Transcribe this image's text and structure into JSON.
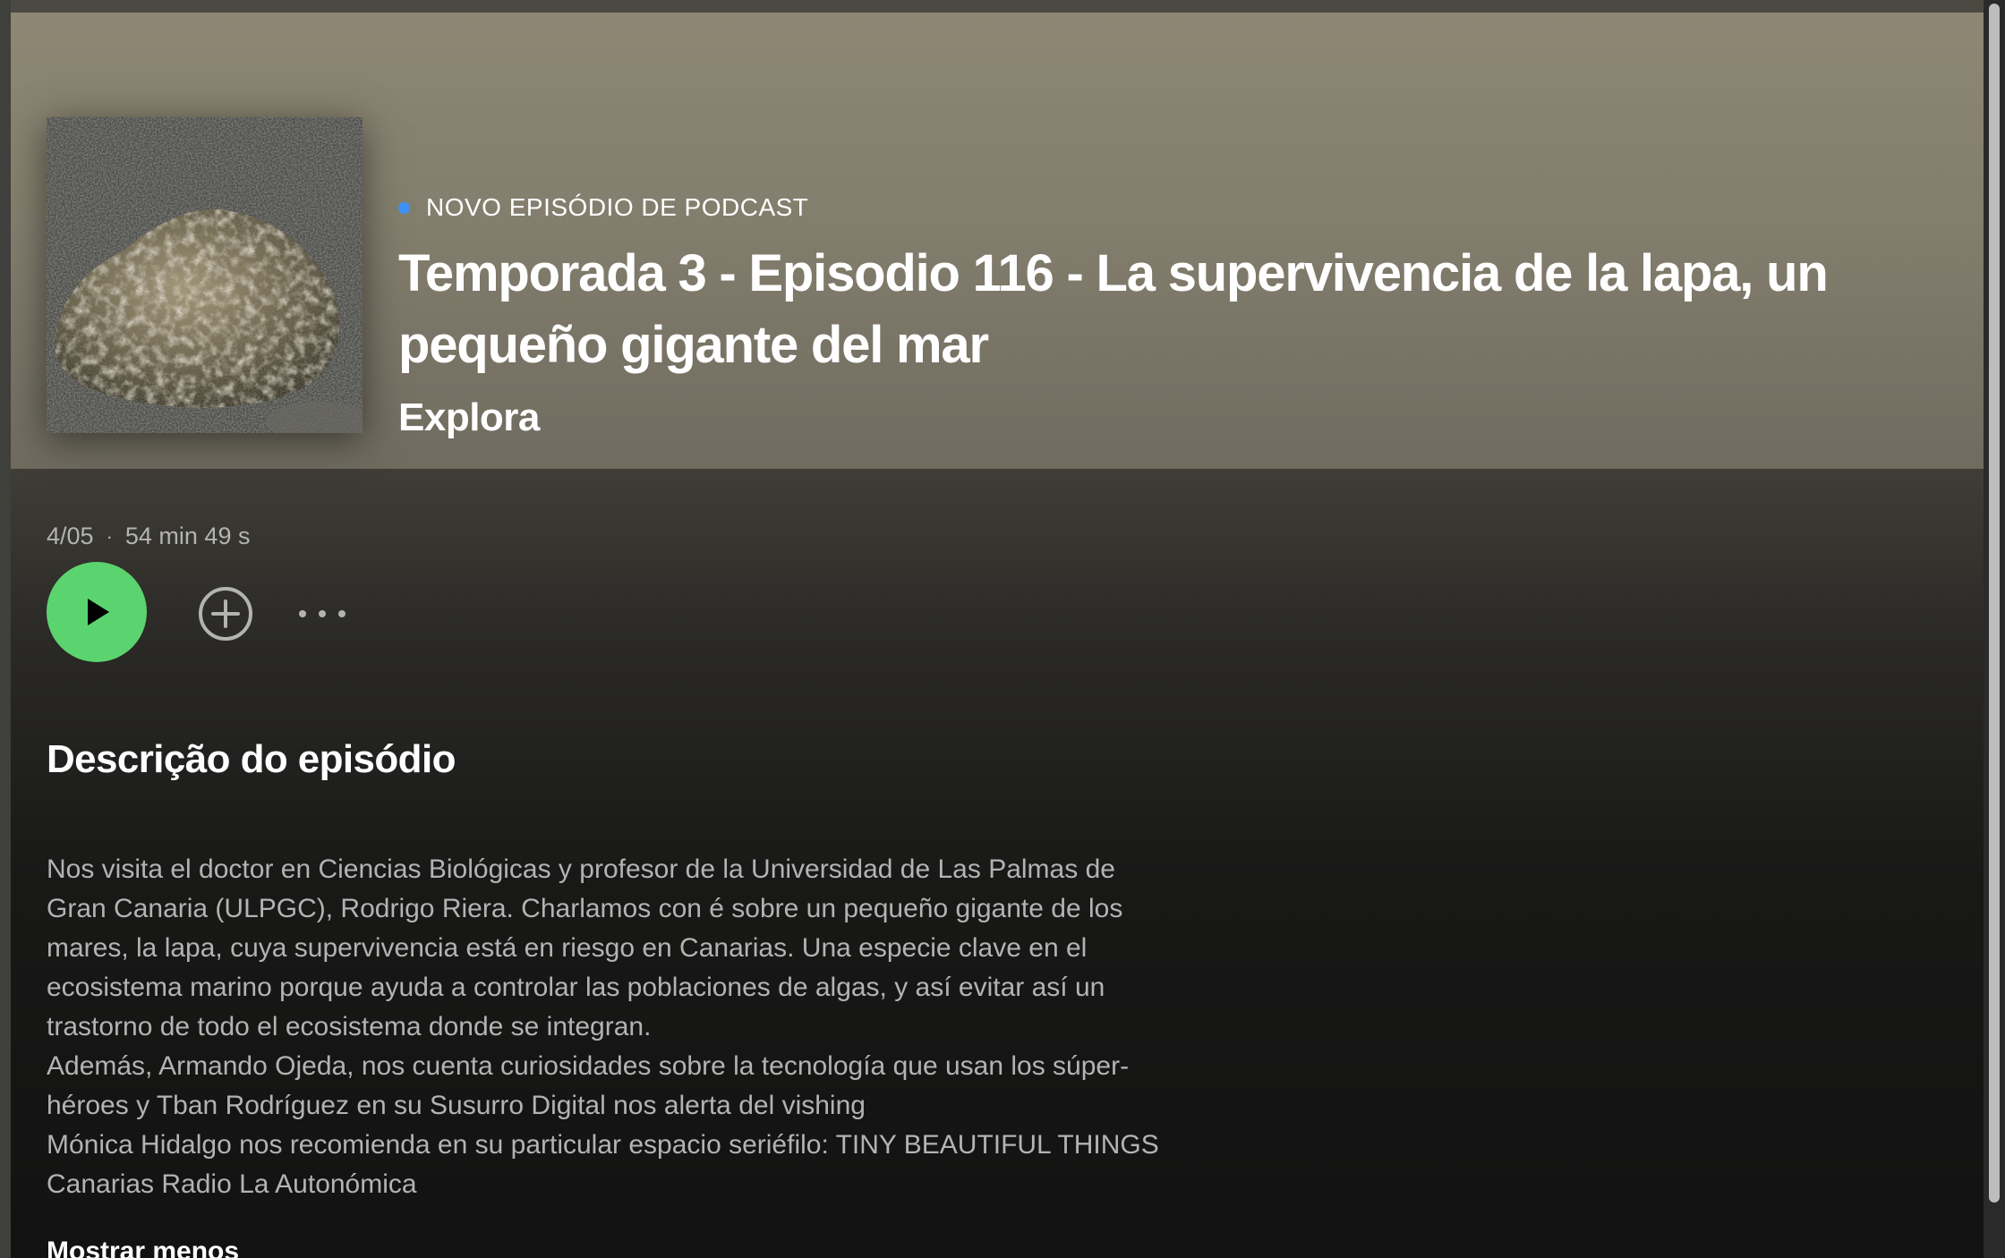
{
  "episode": {
    "kicker": "NOVO EPISÓDIO DE PODCAST",
    "title": "Temporada 3 - Episodio 116 - La supervivencia de la lapa, un pequeño gigante del mar",
    "show": "Explora",
    "date": "4/05",
    "separator": "·",
    "duration": "54 min 49 s"
  },
  "actions": {
    "play": "play-icon",
    "add": "plus-circle-icon",
    "more": "more-dots-icon"
  },
  "description": {
    "heading": "Descrição do episódio",
    "lines": [
      "Nos visita el doctor en Ciencias Biológicas y profesor de la Universidad de Las Palmas de",
      "Gran Canaria (ULPGC), Rodrigo Riera. Charlamos con é sobre un pequeño gigante de los",
      "mares, la lapa, cuya supervivencia está en riesgo en Canarias. Una especie clave en el",
      "ecosistema marino porque ayuda a controlar las poblaciones de algas, y así evitar así un",
      "trastorno de todo el ecosistema donde se integran.",
      "Además, Armando Ojeda, nos cuenta curiosidades sobre la tecnología que usan los súper-",
      "héroes y Tban Rodríguez en su Susurro Digital nos alerta del vishing",
      "Mónica Hidalgo nos recomienda en su particular espacio seriéfilo: TINY BEAUTIFUL THINGS",
      "Canarias Radio La Autonómica"
    ],
    "toggle_label": "Mostrar menos"
  },
  "colors": {
    "accent_green": "#5bd46f",
    "new_dot_blue": "#3d91f4",
    "header_bg": "#8d8774",
    "page_bg": "#121212"
  }
}
